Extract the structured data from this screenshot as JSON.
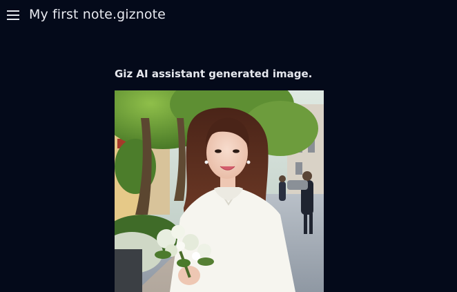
{
  "header": {
    "menu_icon": "hamburger-menu-icon",
    "title": "My first note.giznote"
  },
  "note": {
    "heading": "Giz AI assistant generated image.",
    "image": {
      "subject": "generated-photo"
    }
  },
  "colors": {
    "background": "#040a1a",
    "text": "#e6e8ee"
  }
}
